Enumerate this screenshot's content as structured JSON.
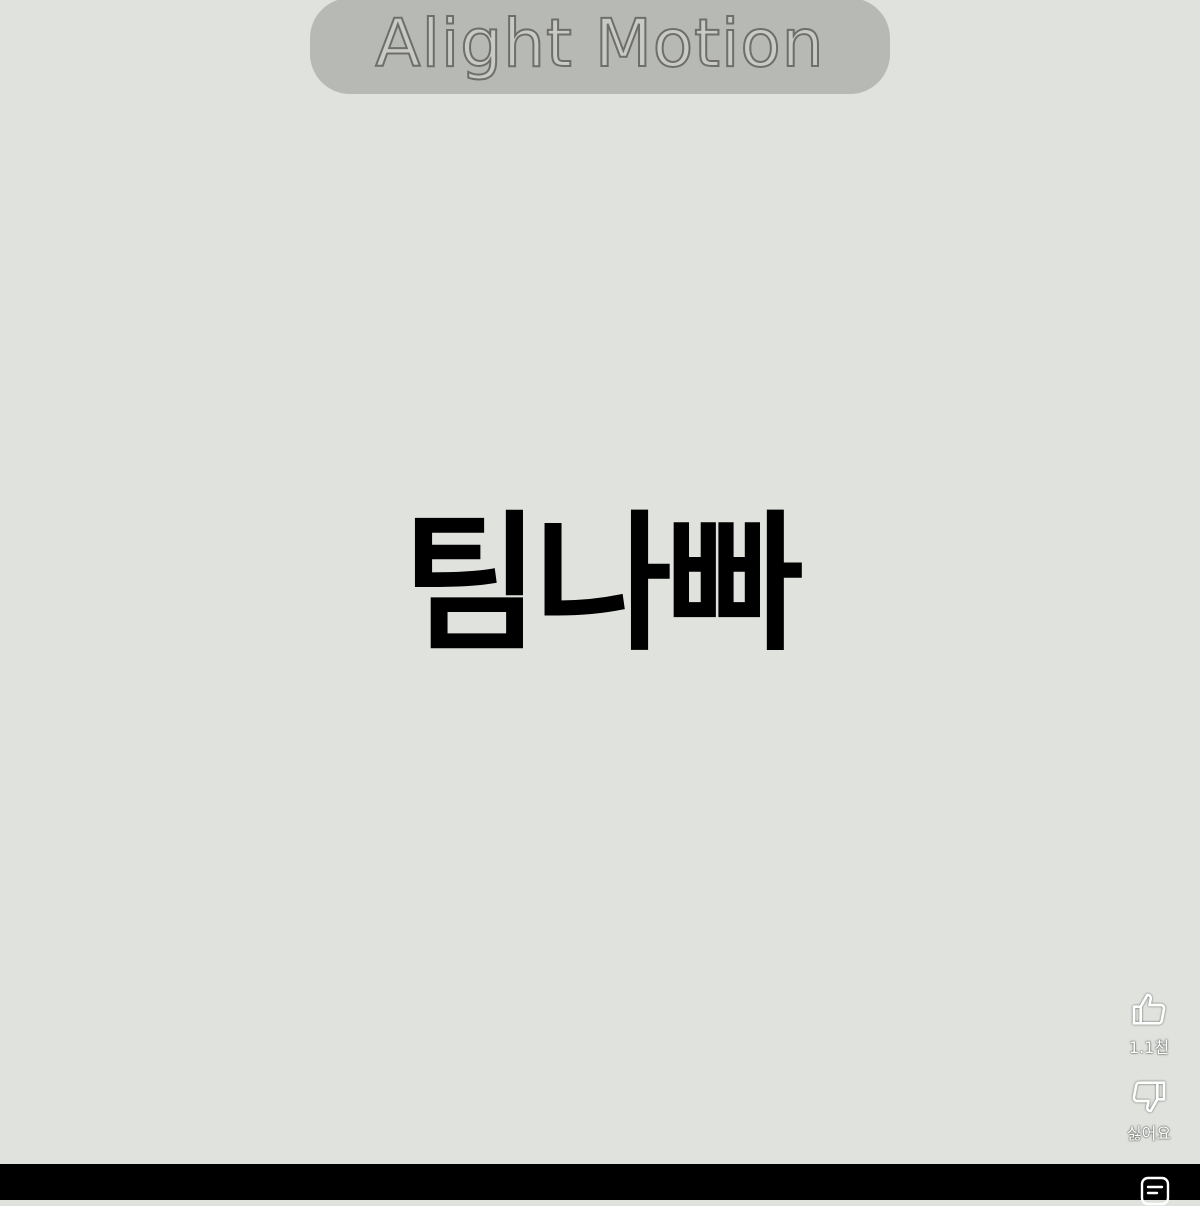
{
  "watermark": {
    "text": "Alight Motion"
  },
  "main": {
    "title": "팀나빠"
  },
  "actions": {
    "like": {
      "icon": "thumbs-up-icon",
      "count": "1.1천"
    },
    "dislike": {
      "icon": "thumbs-down-icon",
      "label": "싫어요"
    }
  },
  "bottom_bar": {
    "comment_icon": "comment-icon"
  },
  "colors": {
    "background": "#e0e3dd",
    "watermark_pill": "#b7b9b4",
    "title": "#000000",
    "bar": "#000000"
  }
}
